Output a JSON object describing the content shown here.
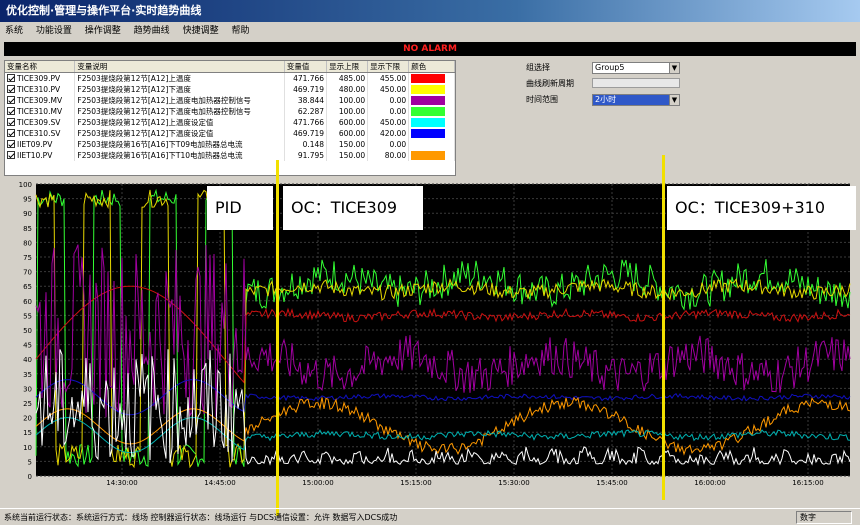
{
  "window": {
    "title": "优化控制·管理与操作平台·实时趋势曲线"
  },
  "menu": [
    "系统",
    "功能设置",
    "操作调整",
    "趋势曲线",
    "快捷调整",
    "帮助"
  ],
  "alarm": {
    "text": "NO ALARM",
    "color": "#ff2020"
  },
  "var_table": {
    "headers": [
      "变量名称",
      "变量说明",
      "变量值",
      "显示上限",
      "显示下限",
      "颜色"
    ],
    "rows": [
      {
        "name": "TICE309.PV",
        "desc": "F2503提烧段第12节[A12]上温度",
        "value": "471.766",
        "upper": "485.00",
        "lower": "455.00",
        "color": "#ff0000"
      },
      {
        "name": "TICE310.PV",
        "desc": "F2503提烧段第12节[A12]下温度",
        "value": "469.719",
        "upper": "480.00",
        "lower": "450.00",
        "color": "#ffff00"
      },
      {
        "name": "TICE309.MV",
        "desc": "F2503提烧段第12节[A12]上温度电加热器控制信号",
        "value": "38.844",
        "upper": "100.00",
        "lower": "0.00",
        "color": "#a000a0"
      },
      {
        "name": "TICE310.MV",
        "desc": "F2503提烧段第12节[A12]下温度电加热器控制信号",
        "value": "62.287",
        "upper": "100.00",
        "lower": "0.00",
        "color": "#33ff33"
      },
      {
        "name": "TICE309.SV",
        "desc": "F2503提烧段第12节[A12]上温度设定值",
        "value": "471.766",
        "upper": "600.00",
        "lower": "450.00",
        "color": "#00ffff"
      },
      {
        "name": "TICE310.SV",
        "desc": "F2503提烧段第12节[A12]下温度设定值",
        "value": "469.719",
        "upper": "600.00",
        "lower": "420.00",
        "color": "#0000ff"
      },
      {
        "name": "IIET09.PV",
        "desc": "F2503提烧段第16节[A16]下T09电加热器总电流",
        "value": "0.148",
        "upper": "150.00",
        "lower": "0.00",
        "color": "#ffffff"
      },
      {
        "name": "IIET10.PV",
        "desc": "F2503提烧段第16节[A16]下T10电加热器总电流",
        "value": "91.795",
        "upper": "150.00",
        "lower": "80.00",
        "color": "#ff9900"
      }
    ]
  },
  "right_panel": {
    "group_label": "组选择",
    "group_value": "Group5",
    "refresh_label": "曲线刷新周期",
    "range_label": "时间范围",
    "range_value": "2小时"
  },
  "annotations": {
    "pid": "PID",
    "oc1": "OC：TICE309",
    "oc2": "OC：TICE309+310"
  },
  "chart_data": {
    "type": "line",
    "ylim": [
      0,
      100
    ],
    "yticks": [
      0,
      5,
      10,
      15,
      20,
      25,
      30,
      35,
      40,
      45,
      50,
      55,
      60,
      65,
      70,
      75,
      80,
      85,
      90,
      95,
      100
    ],
    "xticks": [
      "14:30:00",
      "14:45:00",
      "15:00:00",
      "15:15:00",
      "15:30:00",
      "15:45:00",
      "16:00:00",
      "16:15:00"
    ],
    "grid": true,
    "series": [
      {
        "name": "TICE310.MV",
        "color": "#33ff33",
        "approx_level": 66
      },
      {
        "name": "TICE310.PV",
        "color": "#e6d800",
        "approx_level": 64
      },
      {
        "name": "TICE309.PV",
        "color": "#cc1111",
        "approx_level": 55
      },
      {
        "name": "TICE309.MV",
        "color": "#a000a0",
        "approx_level": 38
      },
      {
        "name": "TICE310.SV",
        "color": "#1010c0",
        "approx_level": 27
      },
      {
        "name": "IIET10.PV",
        "color": "#ff9900",
        "approx_level": 17
      },
      {
        "name": "TICE309.SV",
        "color": "#00b0b0",
        "approx_level": 14
      },
      {
        "name": "IIET09.PV",
        "color": "#ffffff",
        "approx_level": 5
      }
    ]
  },
  "status": {
    "text": "系统当前运行状态：系统运行方式：线场  控制器运行状态：线场运行  与DCS通信设置：允许  数据写入DCS成功",
    "box": "数字"
  }
}
